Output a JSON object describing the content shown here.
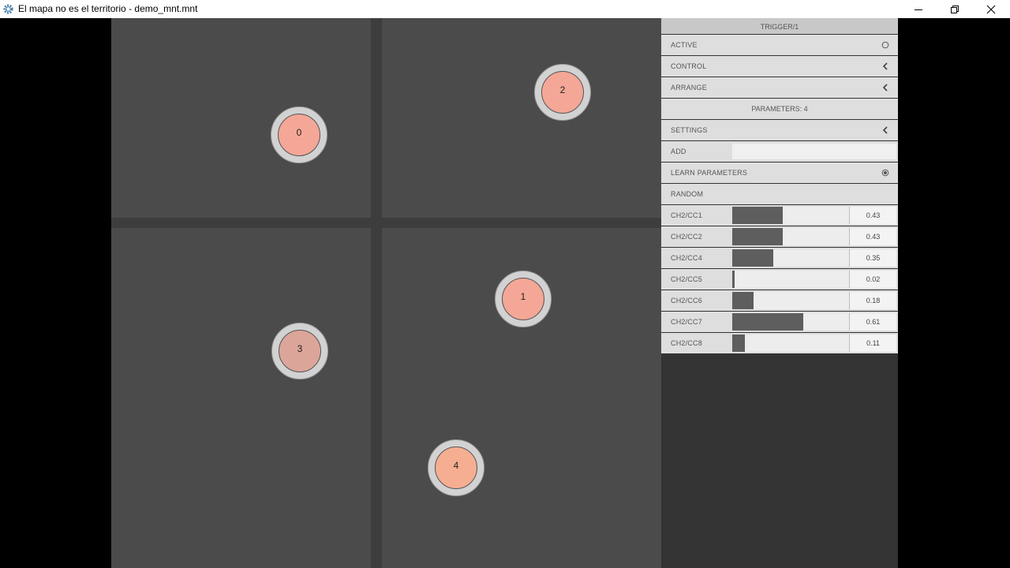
{
  "window": {
    "title": "El mapa no es el territorio - demo_mnt.mnt",
    "app_icon": "gear-icon"
  },
  "map": {
    "nodes": [
      {
        "label": "0",
        "color": "#f4a796"
      },
      {
        "label": "2",
        "color": "#f4a796"
      },
      {
        "label": "1",
        "color": "#f4a796"
      },
      {
        "label": "3",
        "color": "#dca59a"
      },
      {
        "label": "4",
        "color": "#f6ae92"
      }
    ]
  },
  "panel": {
    "header": "TRIGGER/1",
    "active_label": "ACTIVE",
    "control_label": "CONTROL",
    "arrange_label": "ARRANGE",
    "parameters_label": "PARAMETERS: 4",
    "settings_label": "SETTINGS",
    "add_label": "ADD",
    "add_value": "",
    "learn_label": "LEARN PARAMETERS",
    "random_label": "RANDOM",
    "sliders": [
      {
        "name": "CH2/CC1",
        "value": "0.43",
        "fraction": 0.43
      },
      {
        "name": "CH2/CC2",
        "value": "0.43",
        "fraction": 0.43
      },
      {
        "name": "CH2/CC4",
        "value": "0.35",
        "fraction": 0.35
      },
      {
        "name": "CH2/CC5",
        "value": "0.02",
        "fraction": 0.02
      },
      {
        "name": "CH2/CC6",
        "value": "0.18",
        "fraction": 0.18
      },
      {
        "name": "CH2/CC7",
        "value": "0.61",
        "fraction": 0.61
      },
      {
        "name": "CH2/CC8",
        "value": "0.11",
        "fraction": 0.11
      }
    ]
  },
  "colors": {
    "map_background": "#4b4b4b",
    "panel_row": "#dedede",
    "slider_fill": "#5e5e5e"
  }
}
